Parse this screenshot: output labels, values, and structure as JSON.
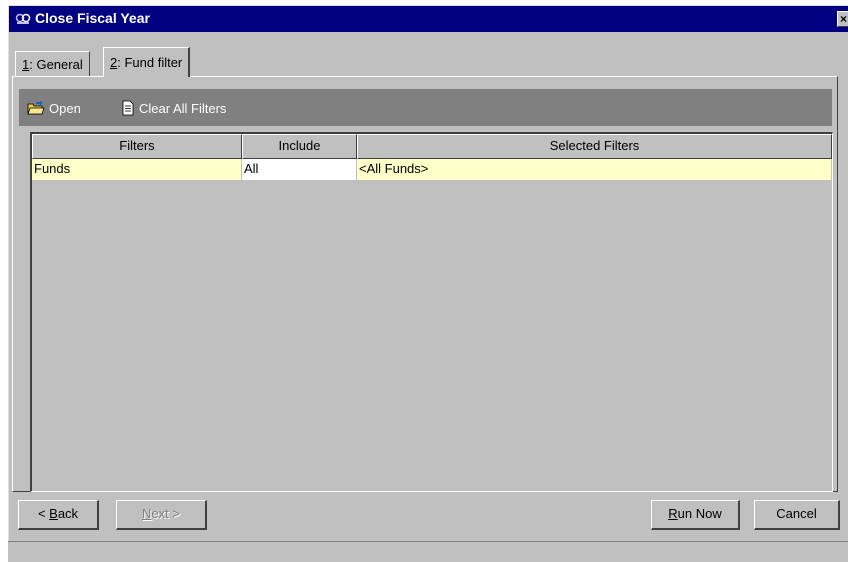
{
  "window": {
    "title": "Close Fiscal Year",
    "close_glyph": "×"
  },
  "tabs": [
    {
      "key": "1",
      "label": ": General"
    },
    {
      "key": "2",
      "label": ": Fund filter"
    }
  ],
  "toolbar": {
    "open_label": "Open",
    "open_icon": "open-folder-icon",
    "clear_label": "Clear All Filters",
    "clear_icon": "document-icon"
  },
  "grid": {
    "columns": [
      "Filters",
      "Include",
      "Selected Filters"
    ],
    "rows": [
      {
        "filters": "Funds",
        "include": "All",
        "selected": "<All Funds>"
      }
    ],
    "row_color": "#ffffc8"
  },
  "buttons": {
    "back_prefix": "< ",
    "back_key": "B",
    "back_rest": "ack",
    "next_key": "N",
    "next_rest": "ext >",
    "run_key": "R",
    "run_rest": "un Now",
    "cancel": "Cancel"
  },
  "colors": {
    "titlebar": "#000080",
    "toolbar": "#808080",
    "window": "#c0c0c0"
  }
}
